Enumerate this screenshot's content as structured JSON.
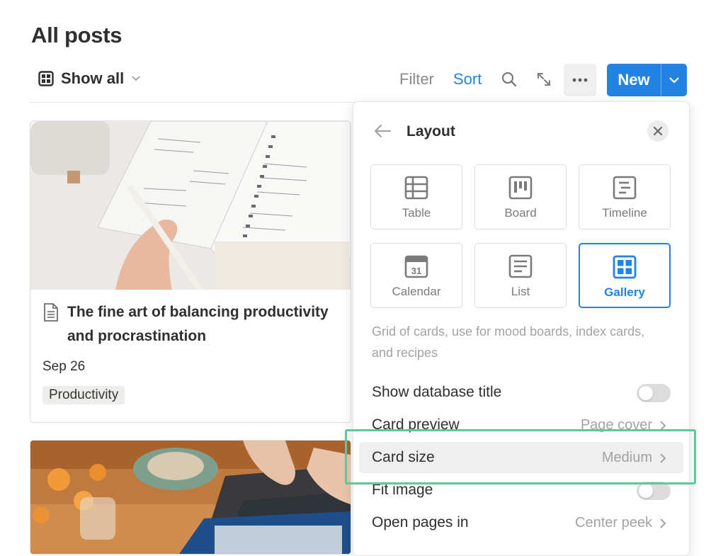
{
  "page": {
    "title": "All posts"
  },
  "toolbar": {
    "view_label": "Show all",
    "filter_label": "Filter",
    "sort_label": "Sort",
    "new_label": "New",
    "icons": [
      "database-view-icon",
      "chevron-down-icon",
      "search-icon",
      "expand-icon",
      "more-icon"
    ]
  },
  "cards": [
    {
      "title": "The fine art of balancing productivity and procrastination",
      "date": "Sep 26",
      "tag": "Productivity",
      "cover": "photo of hand writing in a spiral planner"
    },
    {
      "title": "",
      "cover": "photo of hands typing on a laptop on a wooden table with flowers"
    }
  ],
  "layout_panel": {
    "title": "Layout",
    "options": [
      {
        "label": "Table",
        "icon": "table-icon",
        "selected": false
      },
      {
        "label": "Board",
        "icon": "board-icon",
        "selected": false
      },
      {
        "label": "Timeline",
        "icon": "timeline-icon",
        "selected": false
      },
      {
        "label": "Calendar",
        "icon": "calendar-icon",
        "selected": false
      },
      {
        "label": "List",
        "icon": "list-icon",
        "selected": false
      },
      {
        "label": "Gallery",
        "icon": "gallery-icon",
        "selected": true
      }
    ],
    "calendar_day": "31",
    "description": "Grid of cards, use for mood boards, index cards, and recipes",
    "settings": {
      "show_title": {
        "label": "Show database title",
        "enabled": false
      },
      "card_preview": {
        "label": "Card preview",
        "value": "Page cover"
      },
      "card_size": {
        "label": "Card size",
        "value": "Medium"
      },
      "fit_image": {
        "label": "Fit image",
        "enabled": false
      },
      "open_pages": {
        "label": "Open pages in",
        "value": "Center peek"
      }
    }
  },
  "colors": {
    "accent": "#2383e2",
    "highlight": "#5fc79a",
    "text": "#37352f",
    "muted": "#a3a3a3"
  }
}
